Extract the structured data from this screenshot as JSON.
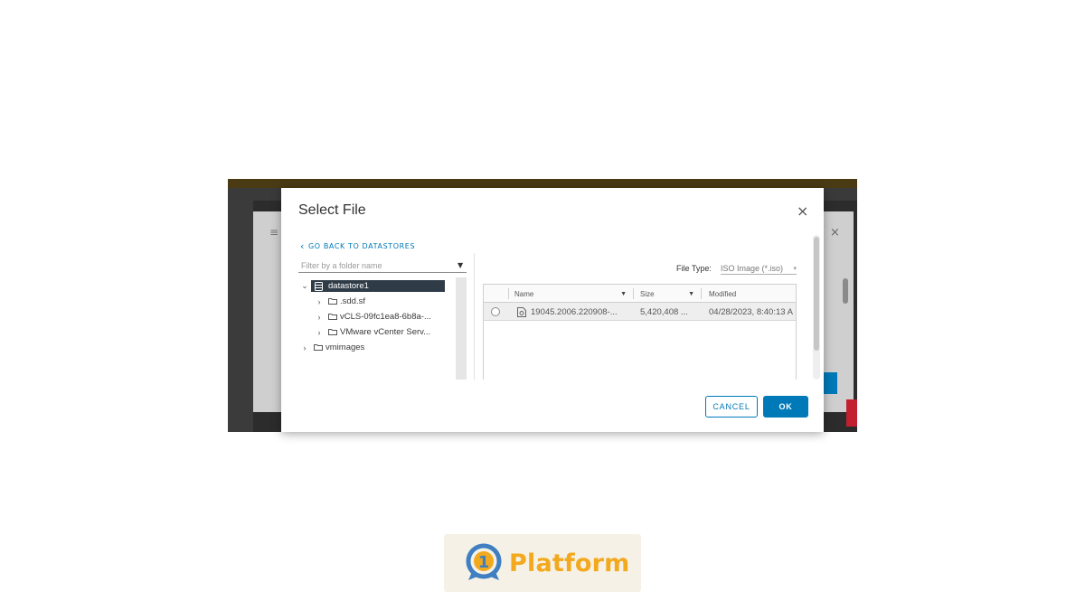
{
  "dialog": {
    "title": "Select File",
    "close_glyph": "×",
    "back_link": "GO BACK TO DATASTORES",
    "filter_placeholder": "Filter by a folder name",
    "tree": [
      {
        "label": "datastore1",
        "level": 0,
        "expanded": true,
        "selected": true,
        "icon": "datastore-icon"
      },
      {
        "label": ".sdd.sf",
        "level": 1,
        "expanded": false,
        "selected": false,
        "icon": "folder-icon"
      },
      {
        "label": "vCLS-09fc1ea8-6b8a-...",
        "level": 1,
        "expanded": false,
        "selected": false,
        "icon": "folder-icon"
      },
      {
        "label": "VMware vCenter Serv...",
        "level": 1,
        "expanded": false,
        "selected": false,
        "icon": "folder-icon"
      },
      {
        "label": "vmimages",
        "level": 0,
        "expanded": false,
        "selected": false,
        "icon": "folder-icon"
      }
    ],
    "file_type_label": "File Type:",
    "file_type_value": "ISO Image (*.iso)",
    "columns": {
      "name": "Name",
      "size": "Size",
      "modified": "Modified"
    },
    "rows": [
      {
        "name": "19045.2006.220908-...",
        "size": "5,420,408 ...",
        "modified": "04/28/2023, 8:40:13 A"
      }
    ],
    "cancel_label": "CANCEL",
    "ok_label": "OK"
  },
  "branding": {
    "logo_text": "Platform",
    "logo_digit": "1"
  },
  "colors": {
    "accent": "#0079b8",
    "selection": "#2f3c48",
    "logo_orange": "#f2a91e",
    "logo_blue": "#3f7fc2"
  }
}
